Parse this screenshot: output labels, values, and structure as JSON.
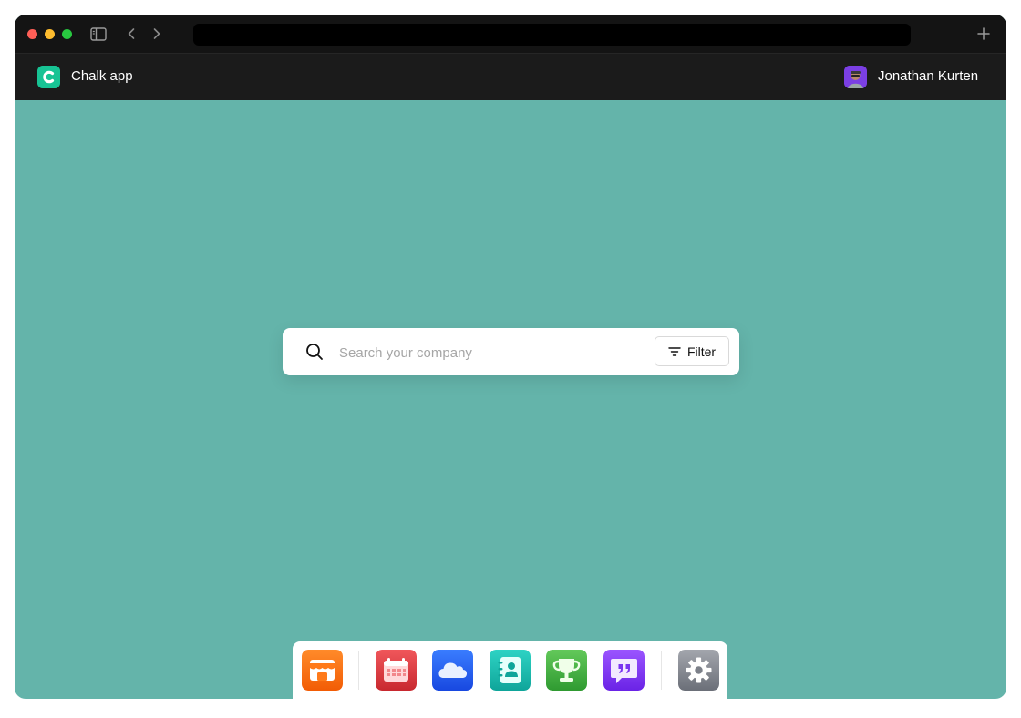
{
  "app": {
    "name": "Chalk app",
    "user_name": "Jonathan Kurten"
  },
  "search": {
    "placeholder": "Search your company",
    "filter_label": "Filter"
  },
  "dock": {
    "apps": [
      "store-icon",
      "calendar-icon",
      "cloud-icon",
      "contacts-icon",
      "trophy-icon",
      "quotes-icon",
      "settings-icon"
    ]
  },
  "colors": {
    "background": "#64b4aa",
    "titlebar": "#141414",
    "appbar": "#1b1b1b",
    "logo": "#17c394",
    "avatar": "#7b3fe4"
  }
}
